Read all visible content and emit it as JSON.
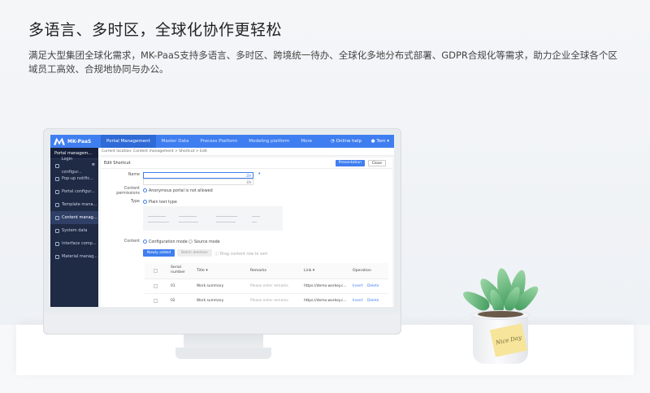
{
  "headline": "多语言、多时区，全球化协作更轻松",
  "description": "满足大型集团全球化需求，MK-PaaS支持多语言、多时区、跨境统一待办、全球化多地分布式部署、GDPR合规化等需求，助力企业全球各个区域员工高效、合规地协同与办公。",
  "app": {
    "logo_text": "MK-PaaS",
    "nav": [
      "Portal Management",
      "Master Data",
      "Process Platform",
      "Modeling platform",
      "More"
    ],
    "help": "Online help",
    "user": "Tom",
    "sidebar_title": "Portal managem...",
    "sidebar": [
      "Login configur...",
      "Pop-up notific...",
      "Portal configur...",
      "Template mana...",
      "Content manag...",
      "System data",
      "Interface comp...",
      "Material manag..."
    ],
    "breadcrumb": "Current location: Content management > Shortcut > Edit",
    "panel_title": "Edit Shortcut",
    "btn_presentation": "Presentation",
    "btn_close": "Close",
    "form": {
      "name_label": "Name",
      "name_lang_1": "ZH",
      "name_lang_2": "EN",
      "permissions_label": "Content permissions",
      "permissions_option": "Anonymous portal is not allowed",
      "type_label": "Type",
      "type_option": "Plain text type",
      "content_label": "Content",
      "mode_config": "Configuration mode",
      "mode_source": "Source mode",
      "btn_new": "Newly added",
      "btn_batch": "Batch deletion",
      "drag_hint": "Drag content row to sort"
    },
    "table": {
      "headers": [
        "Serial number",
        "Title",
        "Remarks",
        "Link",
        "Operation"
      ],
      "rows": [
        {
          "serial": "01",
          "title": "Work summary",
          "remarks": "Please enter remarks",
          "link": "https://demo.workey.c...",
          "ops": [
            "Insert",
            "Delete"
          ]
        },
        {
          "serial": "02",
          "title": "Work summary",
          "remarks": "Please enter remarks",
          "link": "https://demo.workey.c...",
          "ops": [
            "Insert",
            "Delete"
          ]
        }
      ]
    }
  },
  "note_text": "Nice Day",
  "colors": {
    "accent": "#3f7ef0",
    "sidebar": "#1f2a44"
  }
}
